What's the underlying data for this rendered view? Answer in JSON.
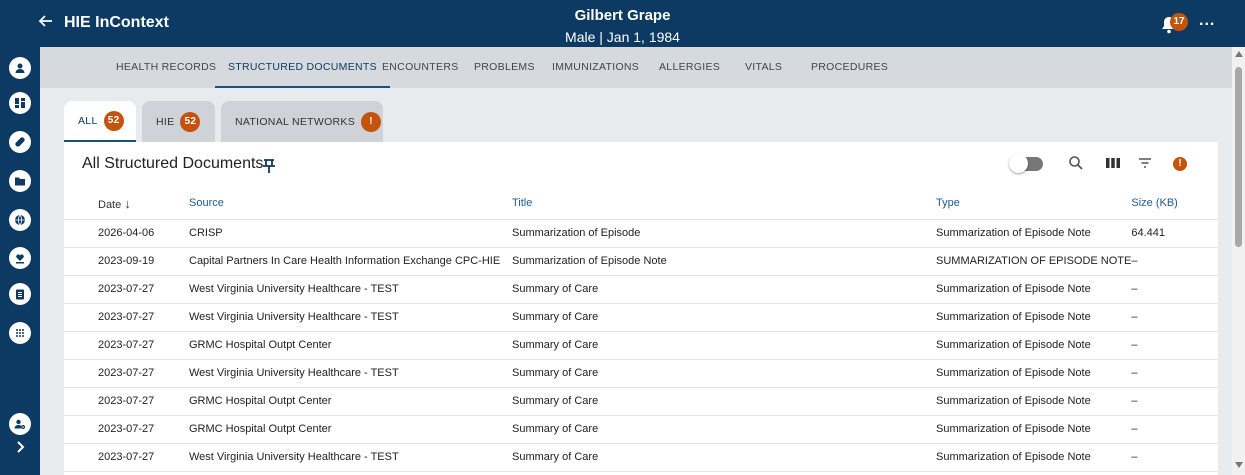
{
  "header": {
    "back_icon": "arrow-left-icon",
    "app_title": "HIE InContext",
    "patient_name": "Gilbert Grape",
    "patient_info": "Male | Jan 1, 1984",
    "notification_count": "17",
    "more_label": "..."
  },
  "rail": {
    "icons": [
      "account-icon",
      "dashboard-icon",
      "pill-icon",
      "folder-icon",
      "globe-icon",
      "heart-hand-icon",
      "clipboard-icon",
      "apps-grid-icon",
      "user-settings-icon",
      "chevron-right-icon"
    ]
  },
  "nav_tabs": [
    {
      "label": "HEALTH RECORDS"
    },
    {
      "label": "STRUCTURED DOCUMENTS"
    },
    {
      "label": "ENCOUNTERS"
    },
    {
      "label": "PROBLEMS"
    },
    {
      "label": "IMMUNIZATIONS"
    },
    {
      "label": "ALLERGIES"
    },
    {
      "label": "VITALS"
    },
    {
      "label": "PROCEDURES"
    }
  ],
  "sub_tabs": [
    {
      "label": "ALL",
      "badge": "52"
    },
    {
      "label": "HIE",
      "badge": "52"
    },
    {
      "label": "NATIONAL NETWORKS",
      "badge": "!"
    }
  ],
  "card": {
    "title": "All Structured Documents",
    "warning_badge": "!"
  },
  "table": {
    "headers": {
      "date": "Date",
      "source": "Source",
      "title": "Title",
      "type": "Type",
      "size": "Size (KB)"
    },
    "rows": [
      {
        "date": "2026-04-06",
        "source": "CRISP",
        "title": "Summarization of Episode",
        "type": "Summarization of Episode Note",
        "size": "64.441"
      },
      {
        "date": "2023-09-19",
        "source": "Capital Partners In Care Health Information Exchange CPC-HIE",
        "title": "Summarization of Episode Note",
        "type": "SUMMARIZATION OF EPISODE NOTE",
        "size": "–"
      },
      {
        "date": "2023-07-27",
        "source": "West Virginia University Healthcare - TEST",
        "title": "Summary of Care",
        "type": "Summarization of Episode Note",
        "size": "–"
      },
      {
        "date": "2023-07-27",
        "source": "West Virginia University Healthcare - TEST",
        "title": "Summary of Care",
        "type": "Summarization of Episode Note",
        "size": "–"
      },
      {
        "date": "2023-07-27",
        "source": "GRMC Hospital Outpt Center",
        "title": "Summary of Care",
        "type": "Summarization of Episode Note",
        "size": "–"
      },
      {
        "date": "2023-07-27",
        "source": "West Virginia University Healthcare - TEST",
        "title": "Summary of Care",
        "type": "Summarization of Episode Note",
        "size": "–"
      },
      {
        "date": "2023-07-27",
        "source": "GRMC Hospital Outpt Center",
        "title": "Summary of Care",
        "type": "Summarization of Episode Note",
        "size": "–"
      },
      {
        "date": "2023-07-27",
        "source": "GRMC Hospital Outpt Center",
        "title": "Summary of Care",
        "type": "Summarization of Episode Note",
        "size": "–"
      },
      {
        "date": "2023-07-27",
        "source": "West Virginia University Healthcare - TEST",
        "title": "Summary of Care",
        "type": "Summarization of Episode Note",
        "size": "–"
      }
    ]
  },
  "colors": {
    "primary": "#0d3a63",
    "accent": "#c4530e",
    "link": "#1f5b93"
  }
}
